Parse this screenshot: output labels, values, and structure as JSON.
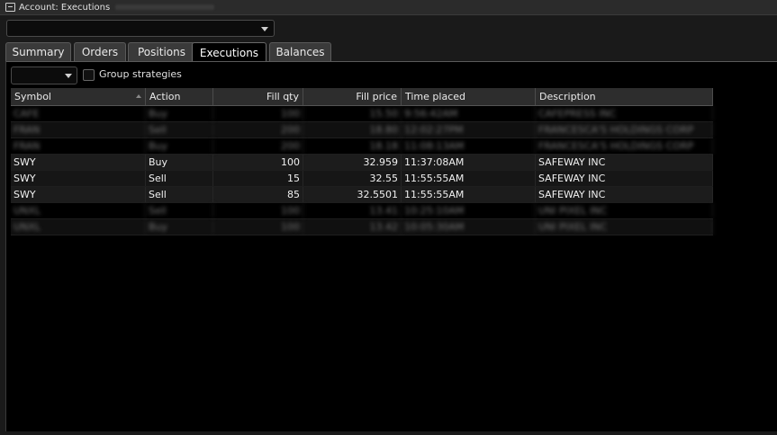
{
  "window": {
    "title": "Account: Executions"
  },
  "account_selector": {
    "value": ""
  },
  "tabs": [
    {
      "label": "Summary",
      "active": false
    },
    {
      "label": "Orders",
      "active": false
    },
    {
      "label": "Positions",
      "active": false
    },
    {
      "label": "Executions",
      "active": true
    },
    {
      "label": "Balances",
      "active": false
    }
  ],
  "filter": {
    "value": "",
    "group_strategies_label": "Group strategies",
    "group_strategies_checked": false
  },
  "table": {
    "columns": [
      "Symbol",
      "Action",
      "Fill qty",
      "Fill price",
      "Time placed",
      "Description"
    ],
    "rows": [
      {
        "symbol": "CAFE",
        "action": "Buy",
        "fill_qty": "100",
        "fill_price": "15.50",
        "time": "9:56:42AM",
        "description": "CAFEPRESS INC",
        "blurred": true
      },
      {
        "symbol": "FRAN",
        "action": "Sell",
        "fill_qty": "200",
        "fill_price": "18.80",
        "time": "12:02:27PM",
        "description": "FRANCESCA'S HOLDINGS CORP",
        "blurred": true
      },
      {
        "symbol": "FRAN",
        "action": "Buy",
        "fill_qty": "200",
        "fill_price": "18.18",
        "time": "11:08:13AM",
        "description": "FRANCESCA'S HOLDINGS CORP",
        "blurred": true
      },
      {
        "symbol": "SWY",
        "action": "Buy",
        "fill_qty": "100",
        "fill_price": "32.959",
        "time": "11:37:08AM",
        "description": "SAFEWAY INC",
        "blurred": false
      },
      {
        "symbol": "SWY",
        "action": "Sell",
        "fill_qty": "15",
        "fill_price": "32.55",
        "time": "11:55:55AM",
        "description": "SAFEWAY INC",
        "blurred": false
      },
      {
        "symbol": "SWY",
        "action": "Sell",
        "fill_qty": "85",
        "fill_price": "32.5501",
        "time": "11:55:55AM",
        "description": "SAFEWAY INC",
        "blurred": false
      },
      {
        "symbol": "UNXL",
        "action": "Sell",
        "fill_qty": "100",
        "fill_price": "13.41",
        "time": "10:25:10AM",
        "description": "UNI PIXEL INC",
        "blurred": true
      },
      {
        "symbol": "UNXL",
        "action": "Buy",
        "fill_qty": "100",
        "fill_price": "13.42",
        "time": "10:05:30AM",
        "description": "UNI PIXEL INC",
        "blurred": true
      }
    ]
  }
}
